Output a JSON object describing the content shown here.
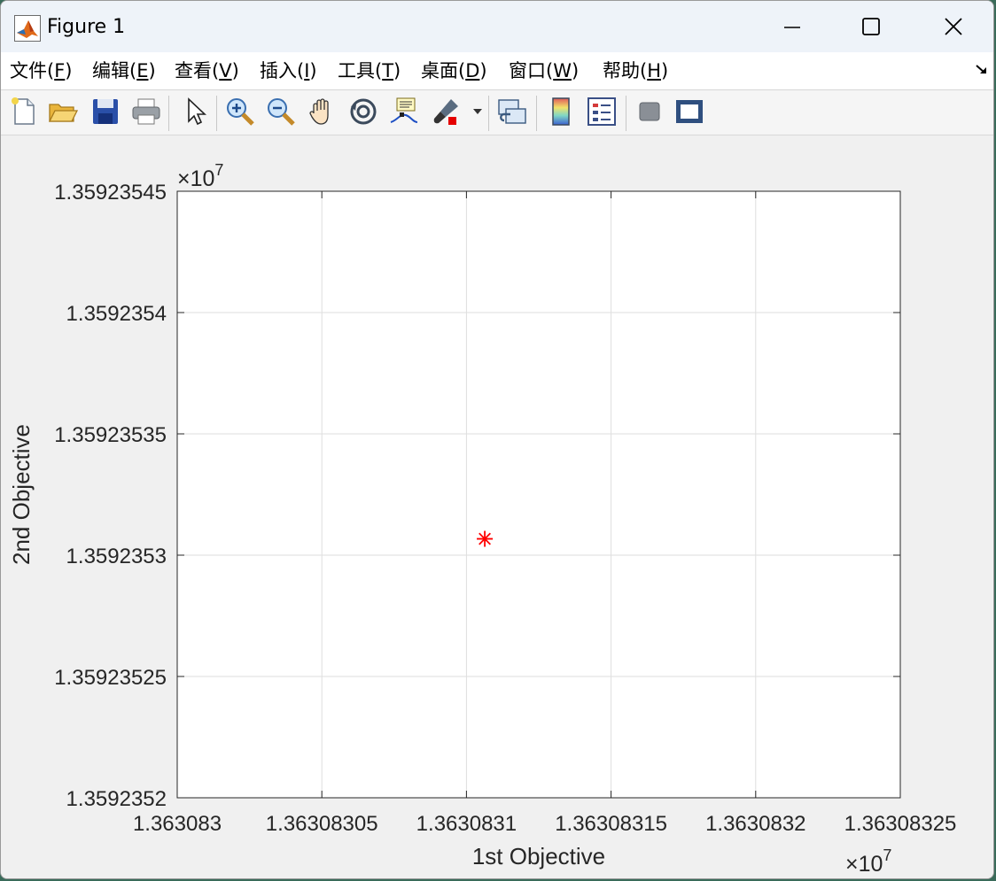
{
  "window": {
    "title": "Figure 1",
    "app_icon": "matlab-logo-icon",
    "controls": [
      "minimize-icon",
      "maximize-icon",
      "close-icon"
    ]
  },
  "menu": {
    "items": [
      {
        "pre": "文件(",
        "key": "F",
        "post": ")"
      },
      {
        "pre": "编辑(",
        "key": "E",
        "post": ")"
      },
      {
        "pre": "查看(",
        "key": "V",
        "post": ")"
      },
      {
        "pre": "插入(",
        "key": "I",
        "post": ")"
      },
      {
        "pre": "工具(",
        "key": "T",
        "post": ")"
      },
      {
        "pre": "桌面(",
        "key": "D",
        "post": ")"
      },
      {
        "pre": "窗口(",
        "key": "W",
        "post": ")"
      },
      {
        "pre": "帮助(",
        "key": "H",
        "post": ")"
      }
    ],
    "dock_icon": "dock-arrow-icon"
  },
  "toolbar": {
    "icons": [
      "new-figure-icon",
      "open-file-icon",
      "save-icon",
      "print-icon",
      "edit-plot-icon",
      "zoom-in-icon",
      "zoom-out-icon",
      "pan-icon",
      "rotate-3d-icon",
      "data-cursor-icon",
      "brush-icon",
      "brush-dropdown-icon",
      "link-plot-icon",
      "insert-colorbar-icon",
      "insert-legend-icon",
      "hide-plot-tools-icon",
      "show-plot-tools-icon"
    ]
  },
  "chart_data": {
    "type": "scatter",
    "title": "",
    "xlabel": "1st Objective",
    "ylabel": "2nd Objective",
    "x_exponent_label": "×10",
    "x_exponent": "7",
    "y_exponent_label": "×10",
    "y_exponent": "7",
    "xlim": [
      1.363083,
      1.36308325
    ],
    "ylim": [
      1.3592352,
      1.35923545
    ],
    "xticks": [
      1.363083,
      1.36308305,
      1.3630831,
      1.36308315,
      1.3630832,
      1.36308325
    ],
    "xtick_labels": [
      "1.363083",
      "1.36308305",
      "1.3630831",
      "1.36308315",
      "1.3630832",
      "1.36308325"
    ],
    "yticks": [
      1.3592352,
      1.35923525,
      1.3592353,
      1.35923535,
      1.3592354,
      1.35923545
    ],
    "ytick_labels": [
      "1.3592352",
      "1.35923525",
      "1.3592353",
      "1.35923535",
      "1.3592354",
      "1.35923545"
    ],
    "grid": true,
    "series": [
      {
        "marker": "asterisk",
        "color": "#ff0000",
        "points": [
          {
            "x": 1.36308310633,
            "y": 1.35923530673
          }
        ]
      }
    ]
  }
}
